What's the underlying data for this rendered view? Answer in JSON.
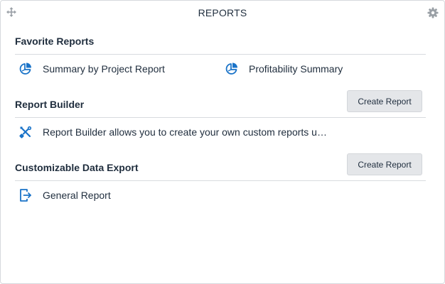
{
  "header": {
    "title": "REPORTS"
  },
  "sections": [
    {
      "title": "Favorite Reports",
      "items": [
        {
          "label": "Summary by Project Report",
          "icon": "pie-chart-icon"
        },
        {
          "label": "Profitability Summary",
          "icon": "pie-chart-icon"
        }
      ]
    },
    {
      "title": "Report Builder",
      "button": "Create Report",
      "items": [
        {
          "label": "Report Builder allows you to create your own custom reports u…",
          "icon": "tools-icon"
        }
      ]
    },
    {
      "title": "Customizable Data Export",
      "button": "Create Report",
      "items": [
        {
          "label": "General Report",
          "icon": "export-icon"
        }
      ]
    }
  ],
  "colors": {
    "accent": "#1a73c8",
    "text": "#1f2d3d",
    "button_bg": "#e4e6e9",
    "divider": "#d8dbdf",
    "icon_gray": "#9aa0a6"
  }
}
